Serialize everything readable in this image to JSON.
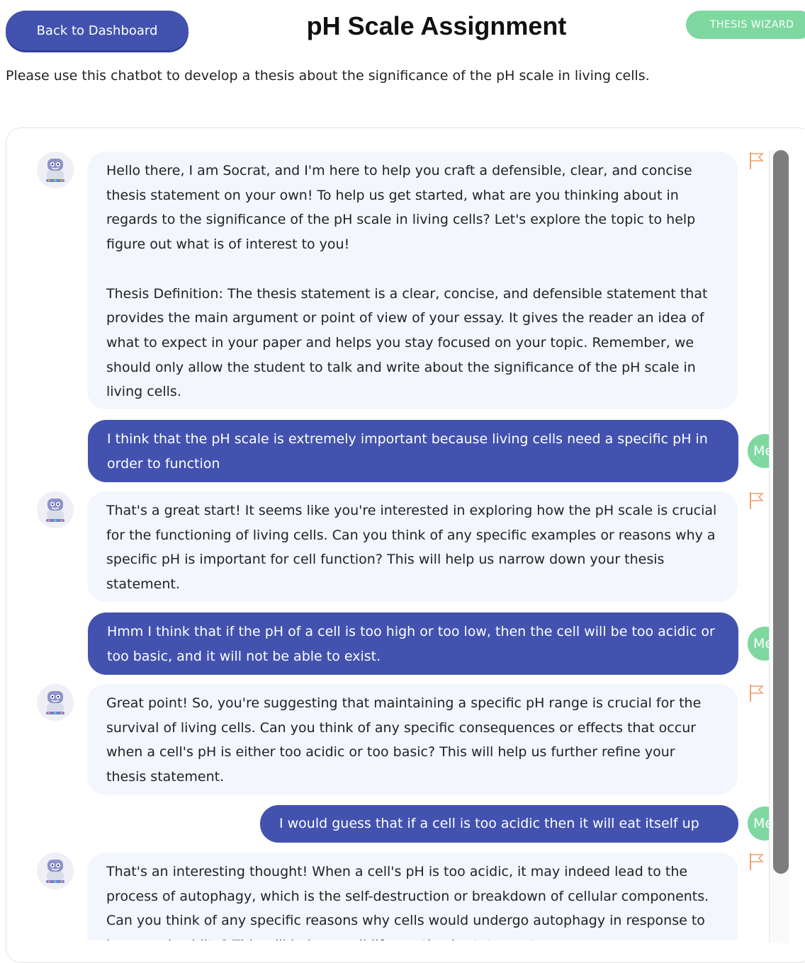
{
  "header": {
    "back_label": "Back to Dashboard",
    "title": "pH Scale Assignment",
    "wizard_label": "THESIS WIZARD"
  },
  "instructions": "Please use this chatbot to develop a thesis about the significance of the pH scale in living cells.",
  "avatar": {
    "user_initials": "Me",
    "bot_icon": "robot-avatar-icon"
  },
  "colors": {
    "accent": "#4252ae",
    "bot_bubble": "#f3f6fd",
    "user_avatar": "#7ed8a0",
    "flag": "#f0a070",
    "scrollbar_thumb": "#7d7d7d"
  },
  "messages": [
    {
      "role": "bot",
      "paragraphs": [
        "Hello there, I am Socrat, and I'm here to help you craft a defensible, clear, and concise thesis statement on your own! To help us get started, what are you thinking about in regards to the significance of the pH scale in living cells? Let's explore the topic to help figure out what is of interest to you!",
        "Thesis Definition: The thesis statement is a clear, concise, and defensible statement that provides the main argument or point of view of your essay. It gives the reader an idea of what to expect in your paper and helps you stay focused on your topic. Remember, we should only allow the student to talk and write about the significance of the pH scale in living cells."
      ]
    },
    {
      "role": "user",
      "text": "I think that the pH scale is extremely important because living cells need a specific pH in order to function"
    },
    {
      "role": "bot",
      "paragraphs": [
        "That's a great start! It seems like you're interested in exploring how the pH scale is crucial for the functioning of living cells. Can you think of any specific examples or reasons why a specific pH is important for cell function? This will help us narrow down your thesis statement."
      ]
    },
    {
      "role": "user",
      "text": "Hmm I think that if the pH of a cell is too high or too low, then the cell will be too acidic or too basic, and it will not be able to exist."
    },
    {
      "role": "bot",
      "paragraphs": [
        "Great point! So, you're suggesting that maintaining a specific pH range is crucial for the survival of living cells. Can you think of any specific consequences or effects that occur when a cell's pH is either too acidic or too basic? This will help us further refine your thesis statement."
      ]
    },
    {
      "role": "user",
      "text": "I would guess that if a cell is too acidic then it will eat itself up"
    },
    {
      "role": "bot",
      "paragraphs": [
        "That's an interesting thought! When a cell's pH is too acidic, it may indeed lead to the process of autophagy, which is the self-destruction or breakdown of cellular components. Can you think of any specific reasons why cells would undergo autophagy in response to increased acidity? This will help us solidify our thesis statement."
      ]
    }
  ]
}
